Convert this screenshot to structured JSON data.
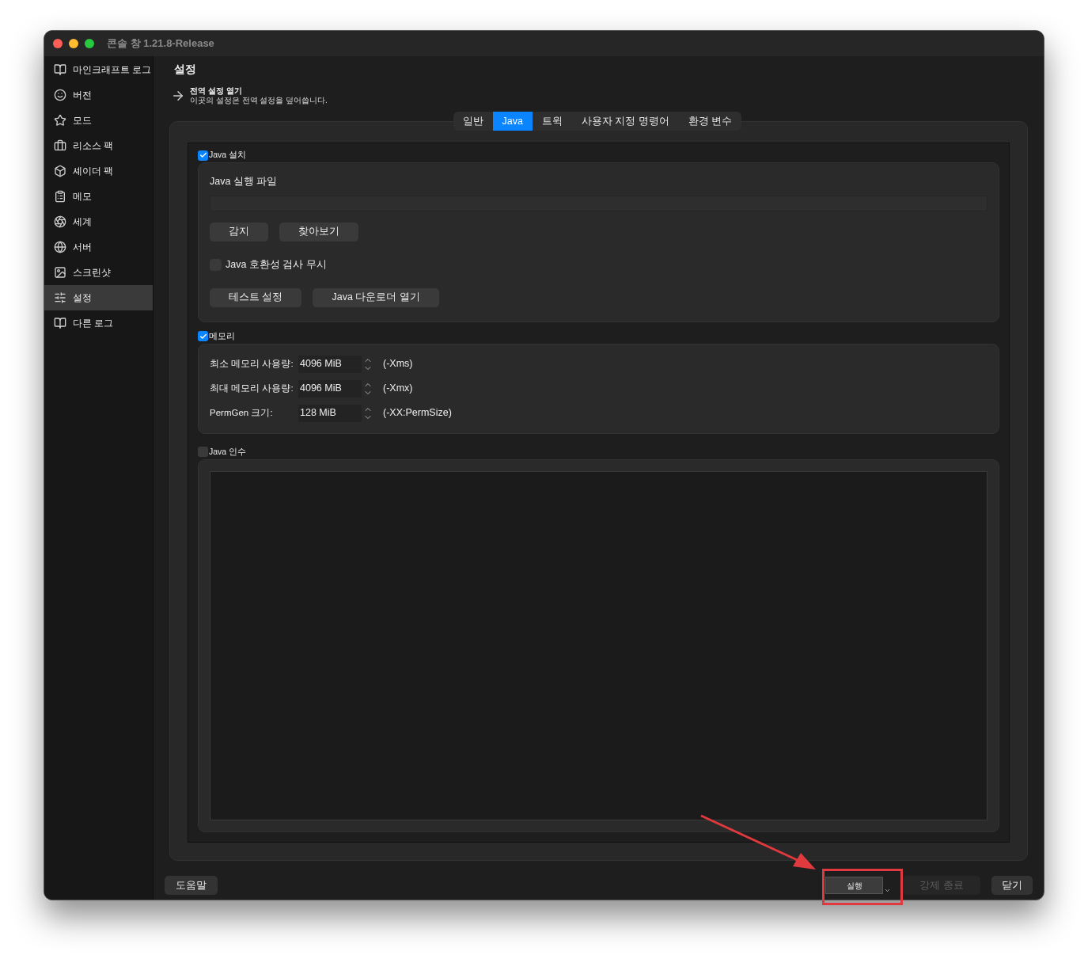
{
  "window": {
    "title": "콘솔 창 1.21.8-Release"
  },
  "sidebar": {
    "items": [
      {
        "label": "마인크래프트 로그",
        "selected": false
      },
      {
        "label": "버전",
        "selected": false
      },
      {
        "label": "모드",
        "selected": false
      },
      {
        "label": "리소스 팩",
        "selected": false
      },
      {
        "label": "셰이더 팩",
        "selected": false
      },
      {
        "label": "메모",
        "selected": false
      },
      {
        "label": "세계",
        "selected": false
      },
      {
        "label": "서버",
        "selected": false
      },
      {
        "label": "스크린샷",
        "selected": false
      },
      {
        "label": "설정",
        "selected": true
      },
      {
        "label": "다른 로그",
        "selected": false
      }
    ]
  },
  "page": {
    "title": "설정"
  },
  "global_settings": {
    "title": "전역 설정 열기",
    "description": "이곳의 설정은 전역 설정을 덮어씁니다."
  },
  "tabs": [
    {
      "label": "일반",
      "selected": false
    },
    {
      "label": "Java",
      "selected": true
    },
    {
      "label": "트윅",
      "selected": false
    },
    {
      "label": "사용자 지정 명령어",
      "selected": false
    },
    {
      "label": "환경 변수",
      "selected": false
    }
  ],
  "java_install": {
    "label": "Java 설치",
    "checked": true,
    "executable_label": "Java 실행 파일",
    "buttons": [
      "감지",
      "찾아보기"
    ],
    "ignore_compat": {
      "label": "Java 호환성 검사 무시",
      "checked": false
    },
    "buttons_2": [
      "테스트 설정",
      "Java 다운로더 열기"
    ]
  },
  "memory": {
    "label": "메모리",
    "checked": true,
    "rows": [
      {
        "label": "최소 메모리 사용량:",
        "value": "4096 MiB",
        "flag": "(-Xms)"
      },
      {
        "label": "최대 메모리 사용량:",
        "value": "4096 MiB",
        "flag": "(-Xmx)"
      },
      {
        "label": "PermGen 크기:",
        "value": "128 MiB",
        "flag": "(-XX:PermSize)"
      }
    ]
  },
  "java_args": {
    "label": "Java 인수",
    "checked": false
  },
  "footer": {
    "help": "도움말",
    "launch": "실행",
    "kill": {
      "label": "강제 종료",
      "disabled": true
    },
    "close": "닫기"
  }
}
